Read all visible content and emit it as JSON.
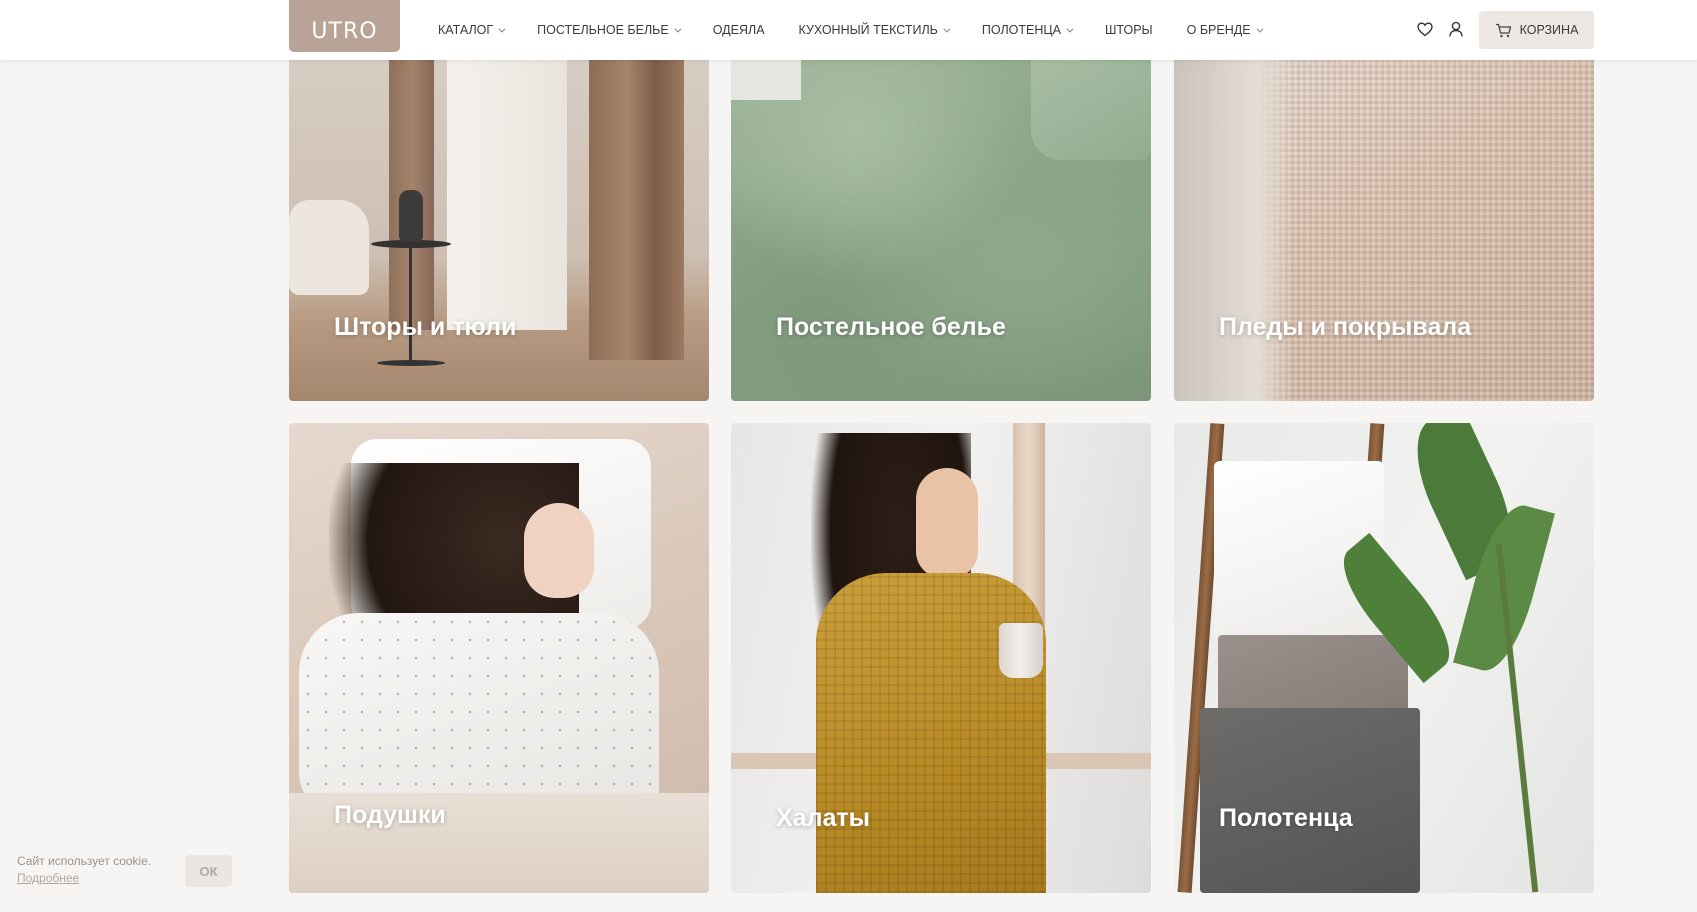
{
  "header": {
    "logo": "UTRO",
    "nav": [
      {
        "label": "КАТАЛОГ",
        "has_dropdown": true
      },
      {
        "label": "ПОСТЕЛЬНОЕ БЕЛЬЕ",
        "has_dropdown": true
      },
      {
        "label": "ОДЕЯЛА",
        "has_dropdown": false
      },
      {
        "label": "КУХОННЫЙ ТЕКСТИЛЬ",
        "has_dropdown": true
      },
      {
        "label": "ПОЛОТЕНЦА",
        "has_dropdown": true
      },
      {
        "label": "ШТОРЫ",
        "has_dropdown": false
      },
      {
        "label": "О БРЕНДЕ",
        "has_dropdown": true
      }
    ],
    "icons": [
      "heart-icon",
      "user-icon",
      "cart-icon"
    ],
    "cart_label": "КОРЗИНА"
  },
  "categories": [
    {
      "label": "Шторы и тюли",
      "image": "curtains-room-photo"
    },
    {
      "label": "Постельное белье",
      "image": "green-bedding-photo"
    },
    {
      "label": "Пледы и покрывала",
      "image": "peach-waffle-blanket-photo"
    },
    {
      "label": "Подушки",
      "image": "woman-sleeping-on-pillow-photo"
    },
    {
      "label": "Халаты",
      "image": "woman-in-mustard-robe-photo"
    },
    {
      "label": "Полотенца",
      "image": "towels-on-ladder-photo"
    }
  ],
  "cookie": {
    "text": "Сайт использует cookie.",
    "link": "Подробнее",
    "ok": "ОК"
  },
  "colors": {
    "brand": "#b8a396",
    "page_bg": "#f7f5f3",
    "cart_bg": "#ece7e3"
  }
}
